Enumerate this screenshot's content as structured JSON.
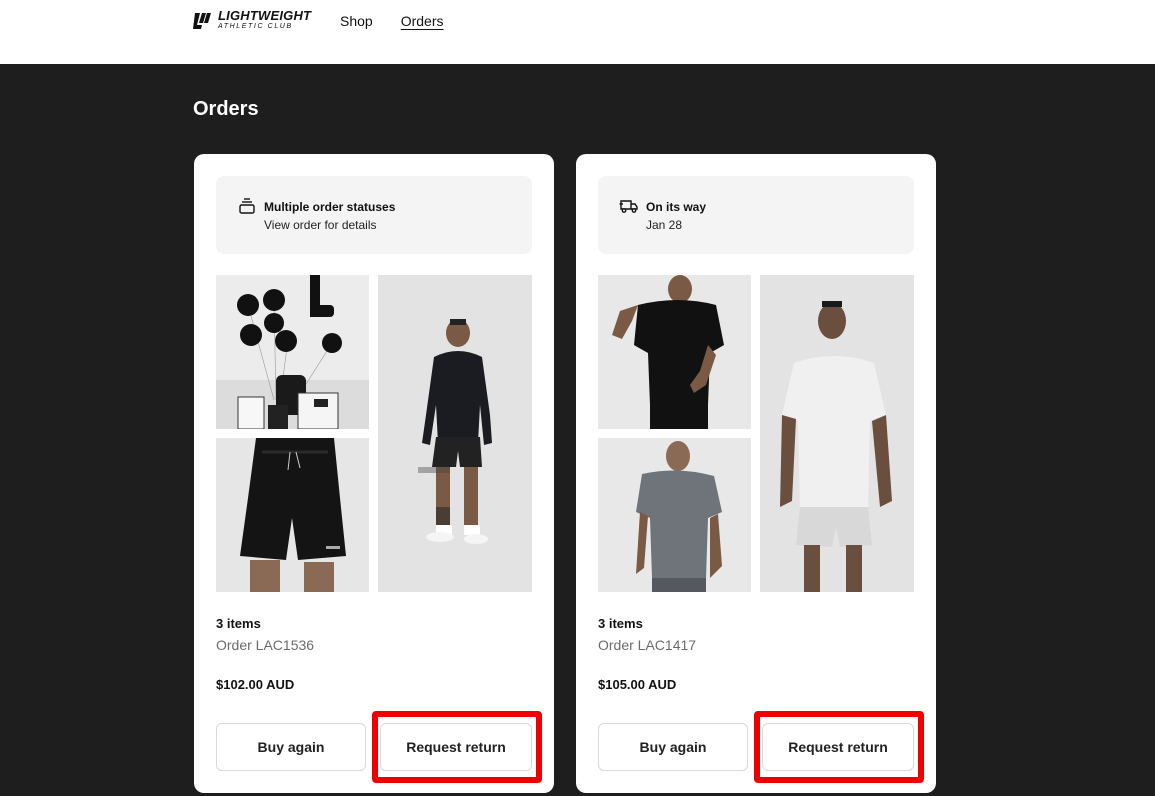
{
  "header": {
    "logo_main": "LIGHTWEIGHT",
    "logo_sub": "ATHLETIC CLUB",
    "nav": [
      {
        "label": "Shop"
      },
      {
        "label": "Orders"
      }
    ]
  },
  "page": {
    "title": "Orders"
  },
  "orders": [
    {
      "status_icon": "stack-icon",
      "status_title": "Multiple order statuses",
      "status_subtitle": "View order for details",
      "images": [
        "balloons-gift-photo",
        "black-shorts-photo",
        "long-sleeve-model-photo"
      ],
      "items_count": "3 items",
      "order_number": "Order LAC1536",
      "price": "$102.00 AUD",
      "buy_again_label": "Buy again",
      "request_return_label": "Request return"
    },
    {
      "status_icon": "delivery-truck-icon",
      "status_title": "On its way",
      "status_subtitle": "Jan 28",
      "images": [
        "black-tee-model-photo",
        "grey-tee-model-photo",
        "white-tee-model-photo"
      ],
      "items_count": "3 items",
      "order_number": "Order LAC1417",
      "price": "$105.00 AUD",
      "buy_again_label": "Buy again",
      "request_return_label": "Request return"
    }
  ],
  "colors": {
    "background": "#1e1e1e",
    "card": "#ffffff",
    "status_box": "#f4f4f4",
    "highlight": "#ee0000"
  }
}
